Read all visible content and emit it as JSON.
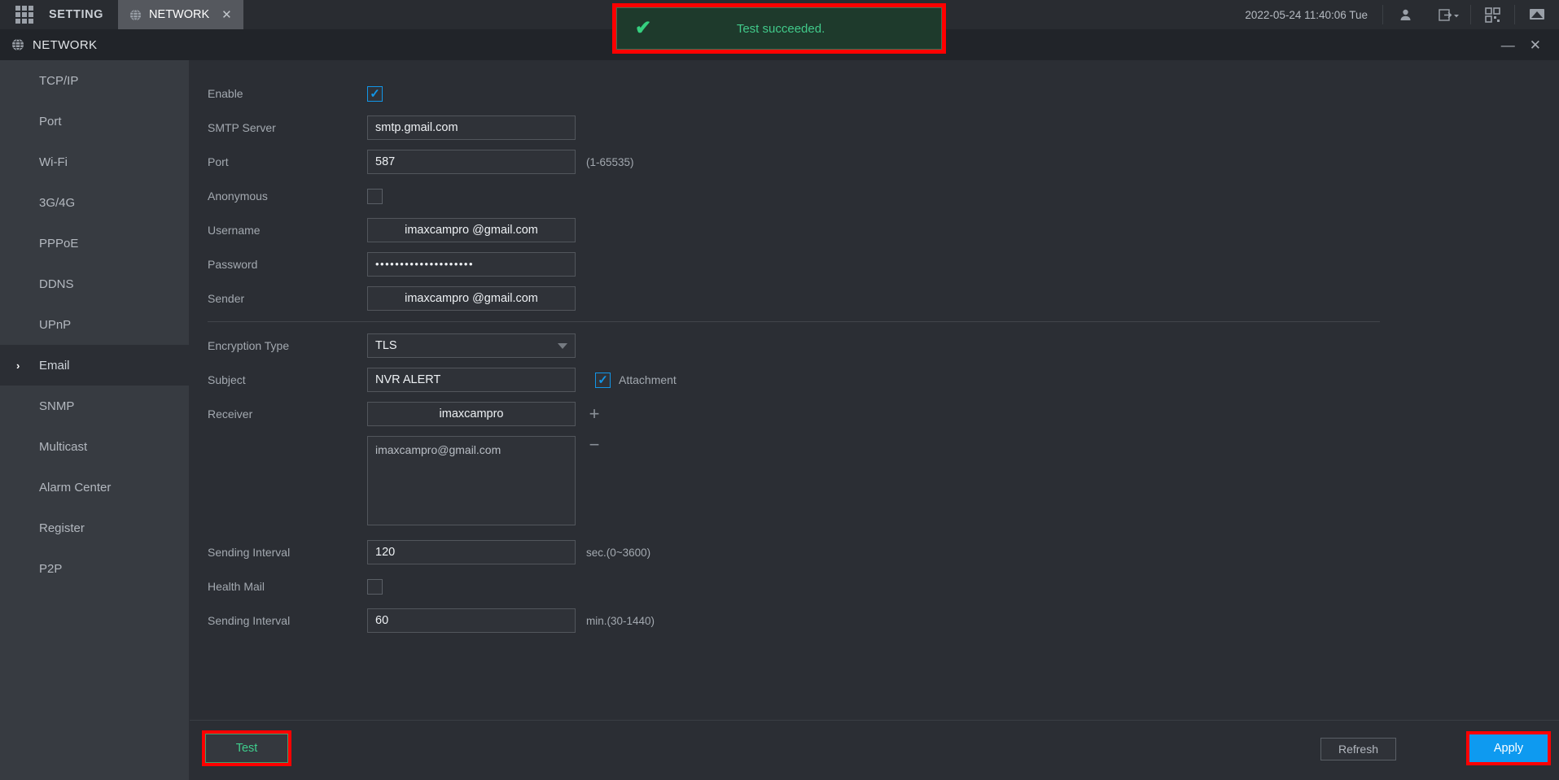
{
  "topbar": {
    "grid_icon": "grid-menu-icon",
    "setting_label": "SETTING",
    "tab": {
      "icon": "globe-icon",
      "label": "NETWORK",
      "close": "✕"
    },
    "clock": "2022-05-24 11:40:06 Tue",
    "icons": [
      "user-icon",
      "logout-icon",
      "qr-code-icon",
      "monitor-icon"
    ]
  },
  "titlebar": {
    "icon": "globe-icon",
    "title": "NETWORK",
    "minimize": "—",
    "close": "✕"
  },
  "toast": {
    "icon": "check-icon",
    "message": "Test succeeded.",
    "bg_color": "#1e3a2c",
    "text_color": "#41c98a",
    "highlight_color": "#ff0000"
  },
  "sidebar": {
    "items": [
      {
        "label": "TCP/IP",
        "active": false
      },
      {
        "label": "Port",
        "active": false
      },
      {
        "label": "Wi-Fi",
        "active": false
      },
      {
        "label": "3G/4G",
        "active": false
      },
      {
        "label": "PPPoE",
        "active": false
      },
      {
        "label": "DDNS",
        "active": false
      },
      {
        "label": "UPnP",
        "active": false
      },
      {
        "label": "Email",
        "active": true
      },
      {
        "label": "SNMP",
        "active": false
      },
      {
        "label": "Multicast",
        "active": false
      },
      {
        "label": "Alarm Center",
        "active": false
      },
      {
        "label": "Register",
        "active": false
      },
      {
        "label": "P2P",
        "active": false
      }
    ],
    "active_chevron": "›"
  },
  "form": {
    "enable": {
      "label": "Enable",
      "checked": true
    },
    "smtp_server": {
      "label": "SMTP Server",
      "value": "smtp.gmail.com"
    },
    "port": {
      "label": "Port",
      "value": "587",
      "hint": "(1-65535)"
    },
    "anonymous": {
      "label": "Anonymous",
      "checked": false
    },
    "username": {
      "label": "Username",
      "value": "imaxcampro @gmail.com"
    },
    "password": {
      "label": "Password",
      "value": "••••••••••••••••••••"
    },
    "sender": {
      "label": "Sender",
      "value": "imaxcampro @gmail.com"
    },
    "encryption_type": {
      "label": "Encryption Type",
      "value": "TLS"
    },
    "subject": {
      "label": "Subject",
      "value": "NVR ALERT"
    },
    "attachment": {
      "label": "Attachment",
      "checked": true
    },
    "receiver": {
      "label": "Receiver",
      "value": "imaxcampro",
      "add_icon": "+",
      "remove_icon": "−",
      "list": [
        "imaxcampro@gmail.com"
      ]
    },
    "sending_interval_sec": {
      "label": "Sending Interval",
      "value": "120",
      "hint": "sec.(0~3600)"
    },
    "health_mail": {
      "label": "Health Mail",
      "checked": false
    },
    "sending_interval_min": {
      "label": "Sending Interval",
      "value": "60",
      "hint": "min.(30-1440)"
    }
  },
  "footer": {
    "test_label": "Test",
    "refresh_label": "Refresh",
    "apply_label": "Apply",
    "apply_color": "#0e9af0"
  }
}
